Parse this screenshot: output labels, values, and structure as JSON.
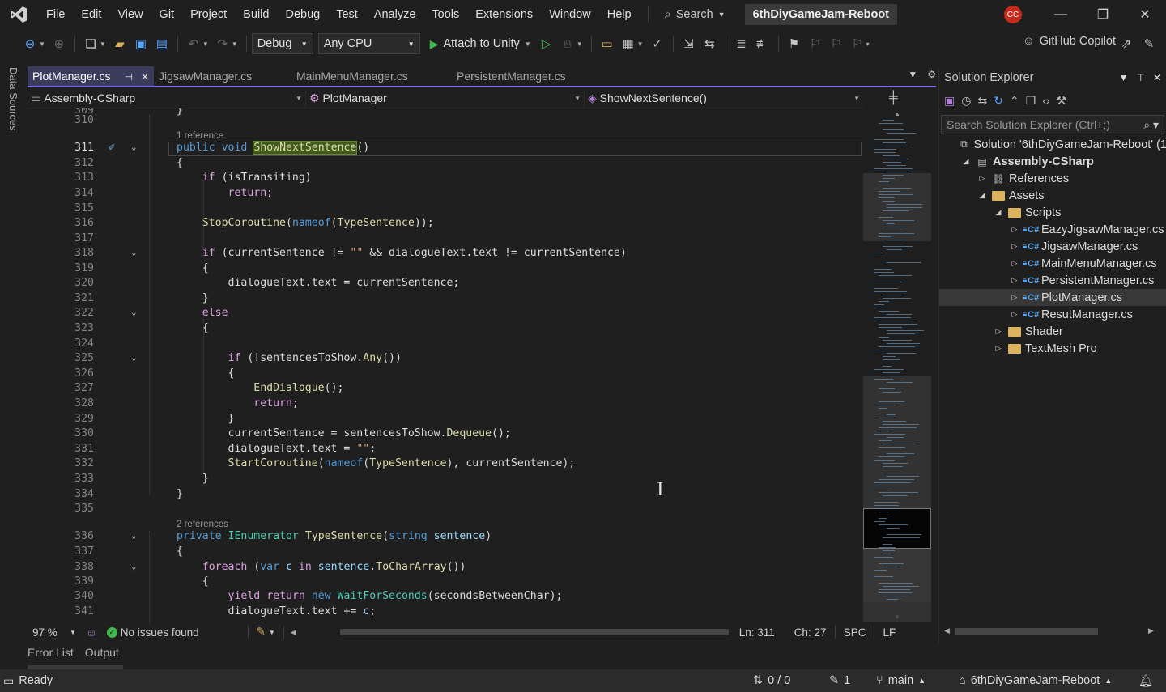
{
  "menubar": {
    "items": [
      "File",
      "Edit",
      "View",
      "Git",
      "Project",
      "Build",
      "Debug",
      "Test",
      "Analyze",
      "Tools",
      "Extensions",
      "Window",
      "Help"
    ],
    "search_label": "Search",
    "solution_name": "6thDiyGameJam-Reboot",
    "avatar_initials": "CC"
  },
  "toolbar": {
    "config": "Debug",
    "platform": "Any CPU",
    "attach_label": "Attach to Unity",
    "copilot_label": "GitHub Copilot"
  },
  "left_strip": {
    "label": "Data Sources"
  },
  "tabs": [
    {
      "label": "PlotManager.cs",
      "active": true
    },
    {
      "label": "JigsawManager.cs",
      "active": false
    },
    {
      "label": "MainMenuManager.cs",
      "active": false
    },
    {
      "label": "PersistentManager.cs",
      "active": false
    }
  ],
  "navbar": {
    "project": "Assembly-CSharp",
    "class": "PlotManager",
    "member": "ShowNextSentence()"
  },
  "code_lines": [
    {
      "n": "309",
      "html": "}"
    },
    {
      "n": "310",
      "html": ""
    },
    {
      "ref": "1 reference"
    },
    {
      "n": "311",
      "cur": true,
      "html": "<span class=\"kw\">public</span> <span class=\"kw\">void</span> <span class=\"hl\">ShowNextSentence</span>()"
    },
    {
      "n": "312",
      "html": "{"
    },
    {
      "n": "313",
      "html": "    <span class=\"ctl\">if</span> (isTransiting)"
    },
    {
      "n": "314",
      "html": "        <span class=\"ctl\">return</span>;"
    },
    {
      "n": "315",
      "html": ""
    },
    {
      "n": "316",
      "html": "    <span class=\"fn\">StopCoroutine</span>(<span class=\"kw\">nameof</span>(<span class=\"fn\">TypeSentence</span>));"
    },
    {
      "n": "317",
      "html": ""
    },
    {
      "n": "318",
      "html": "    <span class=\"ctl\">if</span> (currentSentence != <span class=\"str\">\"\"</span> &amp;&amp; dialogueText.text != currentSentence)"
    },
    {
      "n": "319",
      "html": "    {"
    },
    {
      "n": "320",
      "html": "        dialogueText.text = currentSentence;"
    },
    {
      "n": "321",
      "html": "    }"
    },
    {
      "n": "322",
      "html": "    <span class=\"ctl\">else</span>"
    },
    {
      "n": "323",
      "html": "    {"
    },
    {
      "n": "324",
      "html": ""
    },
    {
      "n": "325",
      "html": "        <span class=\"ctl\">if</span> (!sentencesToShow.<span class=\"fn\">Any</span>())"
    },
    {
      "n": "326",
      "html": "        {"
    },
    {
      "n": "327",
      "html": "            <span class=\"fn\">EndDialogue</span>();"
    },
    {
      "n": "328",
      "html": "            <span class=\"ctl\">return</span>;"
    },
    {
      "n": "329",
      "html": "        }"
    },
    {
      "n": "330",
      "html": "        currentSentence = sentencesToShow.<span class=\"fn\">Dequeue</span>();"
    },
    {
      "n": "331",
      "html": "        dialogueText.text = <span class=\"str\">\"\"</span>;"
    },
    {
      "n": "332",
      "html": "        <span class=\"fn\">StartCoroutine</span>(<span class=\"kw\">nameof</span>(<span class=\"fn\">TypeSentence</span>), currentSentence);"
    },
    {
      "n": "333",
      "html": "    }"
    },
    {
      "n": "334",
      "html": "}"
    },
    {
      "n": "335",
      "html": ""
    },
    {
      "ref": "2 references"
    },
    {
      "n": "336",
      "html": "<span class=\"kw\">private</span> <span class=\"ty\">IEnumerator</span> <span class=\"fn\">TypeSentence</span>(<span class=\"kw\">string</span> <span class=\"par\">sentence</span>)"
    },
    {
      "n": "337",
      "html": "{"
    },
    {
      "n": "338",
      "html": "    <span class=\"ctl\">foreach</span> (<span class=\"kw\">var</span> <span class=\"par\">c</span> <span class=\"ctl\">in</span> <span class=\"par\">sentence</span>.<span class=\"fn\">ToCharArray</span>())"
    },
    {
      "n": "339",
      "html": "    {"
    },
    {
      "n": "340",
      "html": "        <span class=\"ctl\">yield</span> <span class=\"ctl\">return</span> <span class=\"kw\">new</span> <span class=\"ty\">WaitForSeconds</span>(secondsBetweenChar);"
    },
    {
      "n": "341",
      "html": "        dialogueText.text += <span class=\"par\">c</span>;"
    }
  ],
  "editor_status": {
    "zoom": "97 %",
    "issues": "No issues found",
    "line": "Ln: 311",
    "col": "Ch: 27",
    "spacing": "SPC",
    "eol": "LF"
  },
  "bottom_tabs": [
    "Error List",
    "Output"
  ],
  "statusbar": {
    "ready": "Ready",
    "changes": "0 / 0",
    "edits": "1",
    "branch": "main",
    "repo": "6thDiyGameJam-Reboot"
  },
  "solution_explorer": {
    "title": "Solution Explorer",
    "search_placeholder": "Search Solution Explorer (Ctrl+;)",
    "solution_label": "Solution '6thDiyGameJam-Reboot' (1",
    "tree": [
      {
        "label": "Assembly-CSharp",
        "depth": 1,
        "icon": "project",
        "bold": true,
        "twisty": "open"
      },
      {
        "label": "References",
        "depth": 2,
        "icon": "references",
        "twisty": "closed"
      },
      {
        "label": "Assets",
        "depth": 2,
        "icon": "folder",
        "twisty": "open"
      },
      {
        "label": "Scripts",
        "depth": 3,
        "icon": "folder",
        "twisty": "open"
      },
      {
        "label": "EazyJigsawManager.cs",
        "depth": 4,
        "icon": "cs",
        "twisty": "closed"
      },
      {
        "label": "JigsawManager.cs",
        "depth": 4,
        "icon": "cs",
        "twisty": "closed"
      },
      {
        "label": "MainMenuManager.cs",
        "depth": 4,
        "icon": "cs",
        "twisty": "closed"
      },
      {
        "label": "PersistentManager.cs",
        "depth": 4,
        "icon": "cs",
        "twisty": "closed"
      },
      {
        "label": "PlotManager.cs",
        "depth": 4,
        "icon": "cs",
        "twisty": "closed",
        "selected": true
      },
      {
        "label": "ResutManager.cs",
        "depth": 4,
        "icon": "cs",
        "twisty": "closed"
      },
      {
        "label": "Shader",
        "depth": 3,
        "icon": "folder",
        "twisty": "closed"
      },
      {
        "label": "TextMesh Pro",
        "depth": 3,
        "icon": "folder",
        "twisty": "closed"
      }
    ]
  },
  "colors": {
    "accent": "#7b68ee",
    "keyword": "#569cd6",
    "type": "#4ec9b0",
    "method": "#dcdcaa",
    "string": "#d69d85",
    "control": "#d8a0df"
  }
}
